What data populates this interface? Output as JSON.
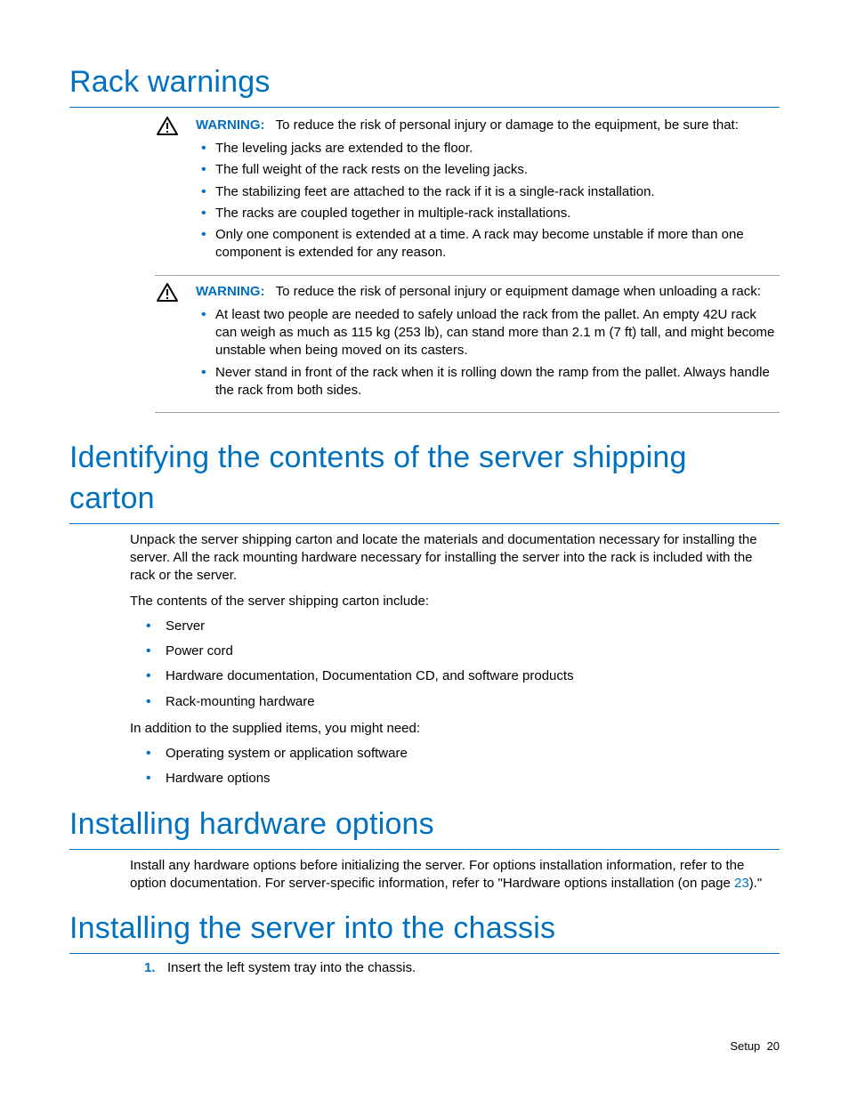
{
  "headings": {
    "rack_warnings": "Rack warnings",
    "identifying": "Identifying the contents of the server shipping carton",
    "hw_options": "Installing hardware options",
    "install_chassis": "Installing the server into the chassis"
  },
  "warnings": {
    "label": "WARNING:",
    "block1": {
      "lead": "To reduce the risk of personal injury or damage to the equipment, be sure that:",
      "items": [
        "The leveling jacks are extended to the floor.",
        "The full weight of the rack rests on the leveling jacks.",
        "The stabilizing feet are attached to the rack if it is a single-rack installation.",
        "The racks are coupled together in multiple-rack installations.",
        "Only one component is extended at a time. A rack may become unstable if more than one component is extended for any reason."
      ]
    },
    "block2": {
      "lead": "To reduce the risk of personal injury or equipment damage when unloading a rack:",
      "items": [
        "At least two people are needed to safely unload the rack from the pallet. An empty 42U rack can weigh as much as 115 kg (253 lb), can stand more than 2.1 m (7 ft) tall, and might become unstable when being moved on its casters.",
        "Never stand in front of the rack when it is rolling down the ramp from the pallet. Always handle the rack from both sides."
      ]
    }
  },
  "identifying": {
    "para1": "Unpack the server shipping carton and locate the materials and documentation necessary for installing the server. All the rack mounting hardware necessary for installing the server into the rack is included with the rack or the server.",
    "para2": "The contents of the server shipping carton include:",
    "contents": [
      "Server",
      "Power cord",
      "Hardware documentation, Documentation CD, and software products",
      "Rack-mounting hardware"
    ],
    "para3": "In addition to the supplied items, you might need:",
    "needs": [
      "Operating system or application software",
      "Hardware options"
    ]
  },
  "hw_options_section": {
    "para_pre": "Install any hardware options before initializing the server. For options installation information, refer to the option documentation. For server-specific information, refer to \"Hardware options installation (on page ",
    "link": "23",
    "para_post": ").\""
  },
  "install_chassis_section": {
    "steps": [
      "Insert the left system tray into the chassis."
    ]
  },
  "footer": {
    "section": "Setup",
    "page": "20"
  }
}
